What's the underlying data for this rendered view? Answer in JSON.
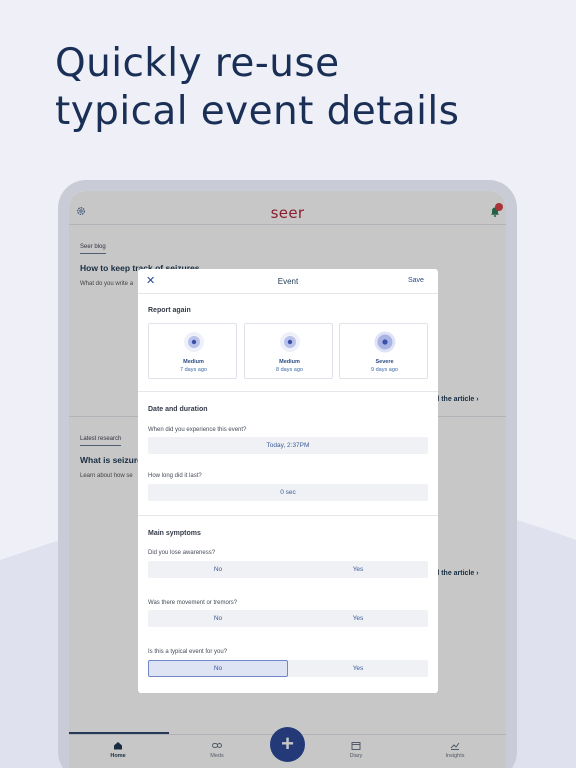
{
  "headline": [
    "Quickly re-use",
    "typical event details"
  ],
  "app": {
    "logo": "seer",
    "notification_count": "1"
  },
  "feed": [
    {
      "tag": "Seer blog",
      "title": "How to keep track of seizures",
      "snippet": "What do you write a",
      "link": "d the article"
    },
    {
      "tag": "Latest research",
      "title": "What is seizure",
      "snippet": "Learn about how se",
      "link": "d the article"
    }
  ],
  "bottom_nav": {
    "home": "Home",
    "meds": "Meds",
    "add": "+",
    "diary": "Diary",
    "insights": "Insights"
  },
  "modal": {
    "close": "✕",
    "title": "Event",
    "save": "Save",
    "report_again": {
      "title": "Report again",
      "cards": [
        {
          "severity": "Medium",
          "when": "7 days ago"
        },
        {
          "severity": "Medium",
          "when": "8 days ago"
        },
        {
          "severity": "Severe",
          "when": "9 days ago"
        }
      ]
    },
    "date_duration": {
      "title": "Date and duration",
      "when_label": "When did you experience this event?",
      "when_value": "Today, 2:37PM",
      "duration_label": "How long did it last?",
      "duration_value": "0 sec"
    },
    "symptoms": {
      "title": "Main symptoms",
      "questions": [
        {
          "label": "Did you lose awareness?",
          "no": "No",
          "yes": "Yes",
          "selected": ""
        },
        {
          "label": "Was there movement or tremors?",
          "no": "No",
          "yes": "Yes",
          "selected": ""
        },
        {
          "label": "Is this a typical event for you?",
          "no": "No",
          "yes": "Yes",
          "selected": "No"
        }
      ]
    }
  },
  "colors": {
    "brand_red": "#b3263e",
    "primary_blue": "#2d4a9a",
    "headline": "#1a2f55"
  }
}
